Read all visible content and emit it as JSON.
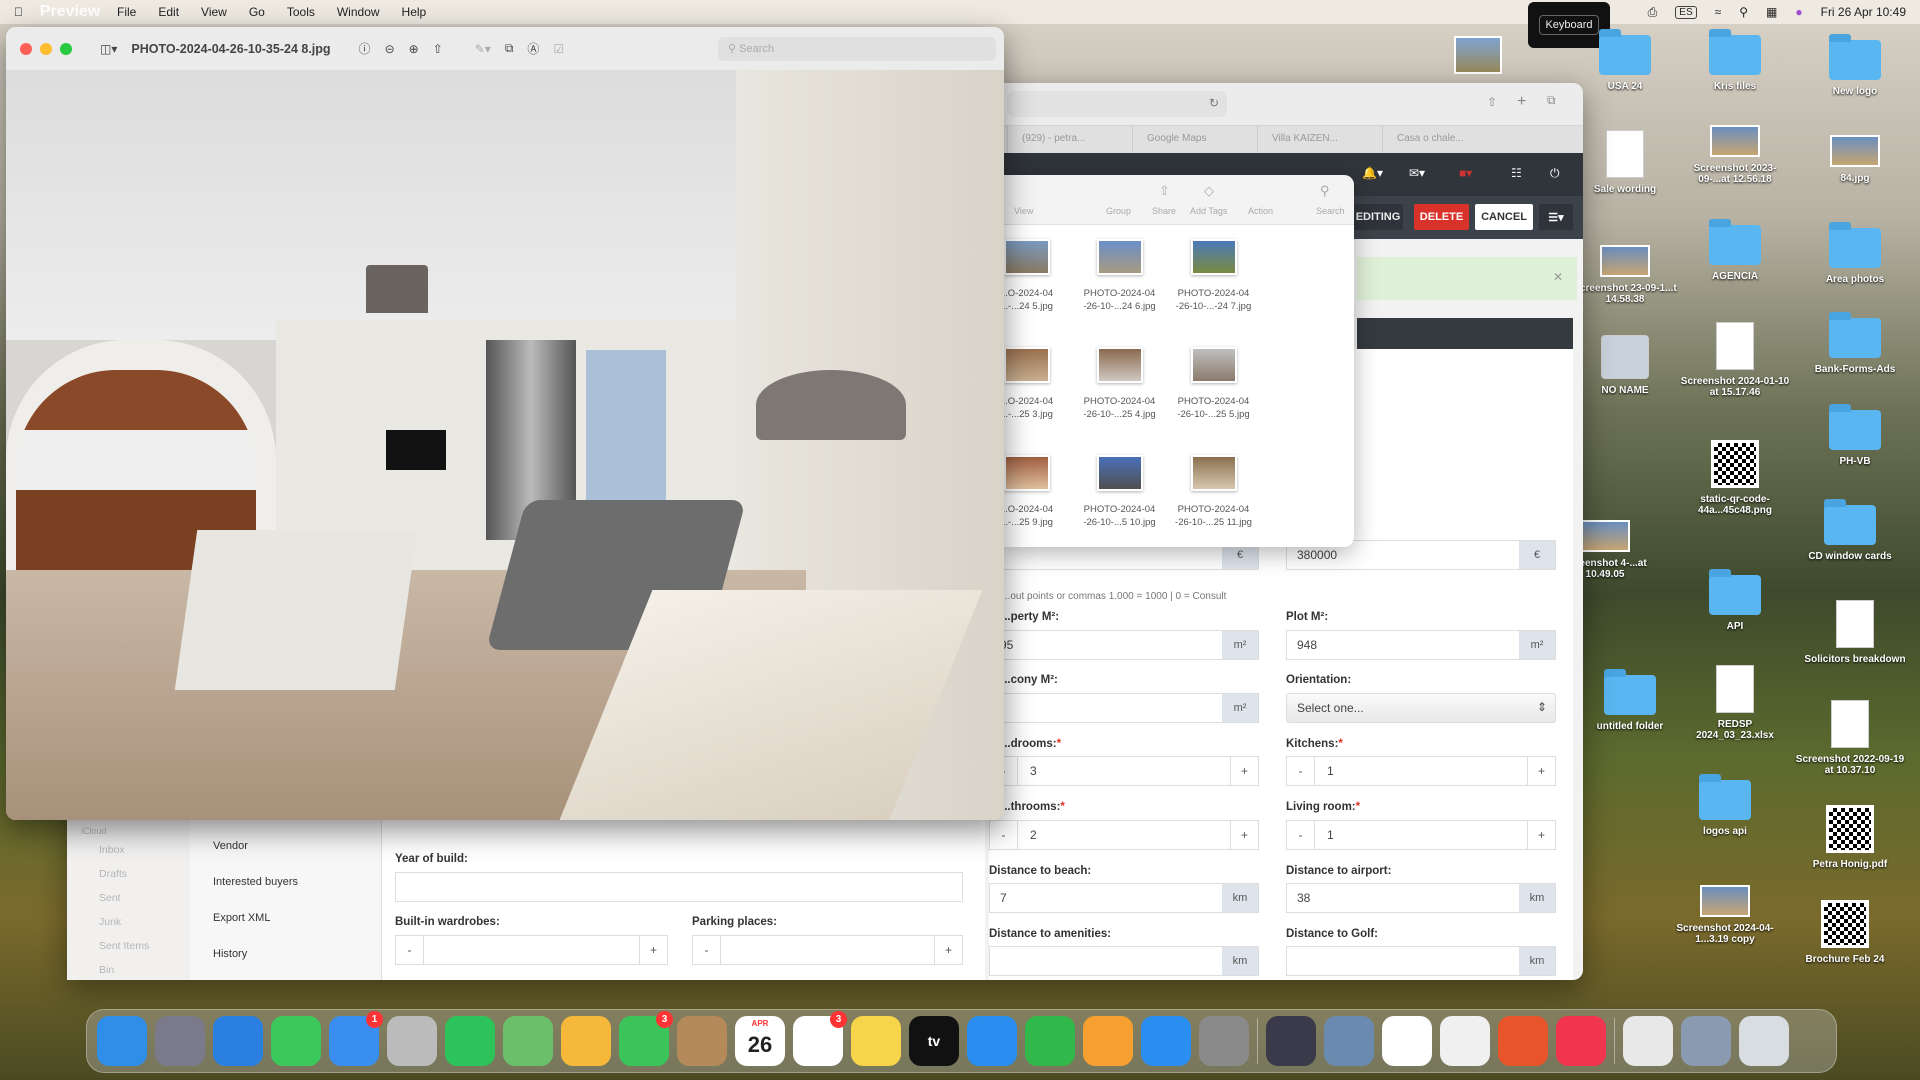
{
  "menubar": {
    "app": "Preview",
    "items": [
      "File",
      "Edit",
      "View",
      "Go",
      "Tools",
      "Window",
      "Help"
    ],
    "input_source": "ES",
    "clock": "Fri 26 Apr 10:49"
  },
  "keyboard_overlay": "Keyboard",
  "desktop": {
    "icons": [
      {
        "label": "USA 24",
        "type": "folder"
      },
      {
        "label": "Kris files",
        "type": "folder"
      },
      {
        "label": "New logo",
        "type": "folder"
      },
      {
        "label": "Sale wording",
        "type": "doc"
      },
      {
        "label": "Screenshot 2023-09-...at 12.56.18",
        "type": "thumb"
      },
      {
        "label": "84.jpg",
        "type": "thumb"
      },
      {
        "label": "Screenshot 23-09-1...t 14.58.38",
        "type": "thumb"
      },
      {
        "label": "AGENCIA",
        "type": "folder"
      },
      {
        "label": "Area photos",
        "type": "folder"
      },
      {
        "label": "NO NAME",
        "type": "drive"
      },
      {
        "label": "Screenshot 2024-01-10 at 15.17.46",
        "type": "doc"
      },
      {
        "label": "Bank-Forms-Ads",
        "type": "folder"
      },
      {
        "label": "static-qr-code-44a...45c48.png",
        "type": "qr"
      },
      {
        "label": "PH-VB",
        "type": "folder"
      },
      {
        "label": "Screenshot 4-...at 10.49.05",
        "type": "thumb"
      },
      {
        "label": "CD window cards",
        "type": "folder"
      },
      {
        "label": "API",
        "type": "folder"
      },
      {
        "label": "Solicitors breakdown",
        "type": "doc"
      },
      {
        "label": "untitled folder",
        "type": "folder"
      },
      {
        "label": "REDSP 2024_03_23.xlsx",
        "type": "doc"
      },
      {
        "label": "Screenshot 2022-09-19 at 10.37.10",
        "type": "doc"
      },
      {
        "label": "logos api",
        "type": "folder"
      },
      {
        "label": "Petra Honig.pdf",
        "type": "qr"
      },
      {
        "label": "Screenshot 2024-04-1...3.19 copy",
        "type": "thumb"
      },
      {
        "label": "Brochure Feb 24",
        "type": "qr"
      }
    ]
  },
  "preview": {
    "title": "PHOTO-2024-04-26-10-35-24 8.jpg",
    "search_placeholder": "Search"
  },
  "browser": {
    "tabs": [
      "(929) - petra...",
      "Google Maps",
      "Villa KAIZEN...",
      "Casa o chale..."
    ],
    "actions": {
      "editing": "EDITING",
      "delete": "DELETE",
      "cancel": "CANCEL"
    },
    "colors": {
      "delete": "#d9322b",
      "header": "#30353b"
    },
    "form": {
      "price_value": "380000",
      "currency": "€",
      "price_hint": "...out points or commas 1.000 = 1000 | 0 = Consult",
      "property_m2_label": "...perty M²:",
      "property_m2": "95",
      "plot_m2_label": "Plot M²:",
      "plot_m2": "948",
      "unit_m2": "m²",
      "balcony_label": "...cony M²:",
      "balcony_m2": "",
      "orientation_label": "Orientation:",
      "orientation_value": "Select one...",
      "bedrooms_label": "...drooms:",
      "bedrooms": "3",
      "kitchens_label": "Kitchens:",
      "kitchens": "1",
      "bathrooms_label": "...throoms:",
      "bathrooms": "2",
      "living_label": "Living room:",
      "living": "1",
      "beach_label": "Distance to beach:",
      "beach": "7",
      "airport_label": "Distance to airport:",
      "airport": "38",
      "amenities_label": "Distance to amenities:",
      "amenities": "",
      "golf_label": "Distance to Golf:",
      "golf": "",
      "unit_km": "km",
      "year_label": "Year of build:",
      "wardrobes_label": "Built-in wardrobes:",
      "parking_label": "Parking places:",
      "minus": "-",
      "plus": "+"
    },
    "side_menu": [
      "Vendor",
      "Interested buyers",
      "Export XML",
      "History"
    ]
  },
  "mail_sidebar": {
    "section": "iCloud",
    "items": [
      "Inbox",
      "Drafts",
      "Sent",
      "Junk",
      "Sent Items",
      "Bin"
    ]
  },
  "finder": {
    "toolbar": [
      "View",
      "Group",
      "Share",
      "Add Tags",
      "Action",
      "Search"
    ],
    "files": [
      [
        "...O-2024-04",
        "...-...24 5.jpg"
      ],
      [
        "PHOTO-2024-04",
        "-26-10-...24 6.jpg"
      ],
      [
        "PHOTO-2024-04",
        "-26-10-...-24 7.jpg"
      ],
      [
        "...O-2024-04",
        "...-...25 3.jpg"
      ],
      [
        "PHOTO-2024-04",
        "-26-10-...25 4.jpg"
      ],
      [
        "PHOTO-2024-04",
        "-26-10-...25 5.jpg"
      ],
      [
        "...O-2024-04",
        "...-...25 9.jpg"
      ],
      [
        "PHOTO-2024-04",
        "-26-10-...5 10.jpg"
      ],
      [
        "PHOTO-2024-04",
        "-26-10-...25 11.jpg"
      ]
    ]
  },
  "dock": {
    "apps": [
      {
        "name": "finder",
        "color": "#2f8fe8"
      },
      {
        "name": "launchpad",
        "color": "#7a7a8a"
      },
      {
        "name": "safari",
        "color": "#2a7fe0"
      },
      {
        "name": "messages",
        "color": "#3cc85a"
      },
      {
        "name": "mail",
        "color": "#3a8ef0",
        "badge": "1"
      },
      {
        "name": "phone",
        "color": "#bbbbbb"
      },
      {
        "name": "whatsapp",
        "color": "#2cc45a"
      },
      {
        "name": "maps",
        "color": "#6bbf6b"
      },
      {
        "name": "photos",
        "color": "#f5b83a"
      },
      {
        "name": "facetime",
        "color": "#3ac45a",
        "badge": "3"
      },
      {
        "name": "contacts",
        "color": "#b58a5a"
      },
      {
        "name": "calendar",
        "color": "#ffffff",
        "text": "26",
        "sub": "APR"
      },
      {
        "name": "reminders",
        "color": "#ffffff",
        "badge": "3"
      },
      {
        "name": "notes",
        "color": "#f7d54a"
      },
      {
        "name": "apple-tv",
        "color": "#111111",
        "text": "tv"
      },
      {
        "name": "keynote",
        "color": "#2a8ef0"
      },
      {
        "name": "numbers",
        "color": "#31b84a"
      },
      {
        "name": "pages",
        "color": "#f5a030"
      },
      {
        "name": "app-store",
        "color": "#2a8ef0"
      },
      {
        "name": "system-settings",
        "color": "#8a8a8a"
      },
      {
        "name": "quicktime",
        "color": "#3a3a4a",
        "sep": true
      },
      {
        "name": "preview",
        "color": "#6a8ab0"
      },
      {
        "name": "freeform",
        "color": "#ffffff"
      },
      {
        "name": "textedit",
        "color": "#f0f0f0"
      },
      {
        "name": "firefox",
        "color": "#e8552a"
      },
      {
        "name": "music",
        "color": "#f2354e"
      },
      {
        "name": "documents",
        "color": "#e8e8e8",
        "sep": true
      },
      {
        "name": "downloads",
        "color": "#8a9ab0"
      },
      {
        "name": "trash",
        "color": "#d8dde2"
      }
    ]
  }
}
